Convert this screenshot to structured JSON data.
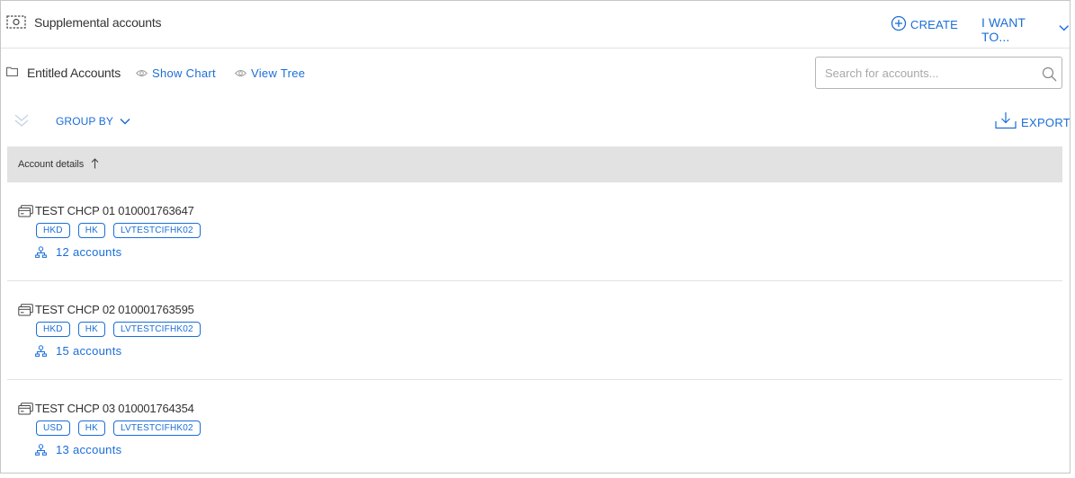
{
  "header": {
    "title": "Supplemental accounts",
    "create_label": "CREATE",
    "want_label": "I WANT TO..."
  },
  "toolbar": {
    "entitled_title": "Entitled Accounts",
    "show_chart_label": "Show Chart",
    "view_tree_label": "View Tree",
    "search_placeholder": "Search for accounts...",
    "group_by_label": "GROUP BY",
    "export_label": "EXPORT"
  },
  "table": {
    "column_header": "Account details",
    "rows": [
      {
        "name": "TEST CHCP 01 010001763647",
        "tags": [
          "HKD",
          "HK",
          "LVTESTCIFHK02"
        ],
        "accounts": "12 accounts"
      },
      {
        "name": "TEST CHCP 02 010001763595",
        "tags": [
          "HKD",
          "HK",
          "LVTESTCIFHK02"
        ],
        "accounts": "15 accounts"
      },
      {
        "name": "TEST CHCP 03 010001764354",
        "tags": [
          "USD",
          "HK",
          "LVTESTCIFHK02"
        ],
        "accounts": "13 accounts"
      }
    ]
  },
  "colors": {
    "accent": "#1a6ed8",
    "header_bg": "#e2e2e2",
    "text": "#333333"
  },
  "icons": {
    "header": "dashed-card-icon",
    "entitled": "folder-icon",
    "view": "eye-icon",
    "create": "plus-circle-icon",
    "search": "search-icon",
    "collapse": "double-chevron-icon",
    "export": "download-icon",
    "row": "account-card-icon",
    "accounts": "hierarchy-icon"
  }
}
